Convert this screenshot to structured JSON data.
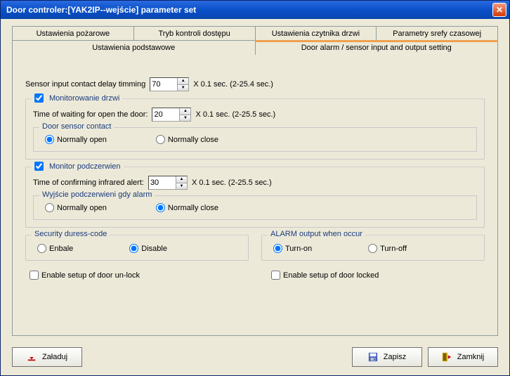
{
  "window": {
    "title": "Door controler:[YAK2IP--wejście] parameter set"
  },
  "tabs_row1": [
    {
      "label": "Ustawienia pożarowe"
    },
    {
      "label": "Tryb kontroli dostępu"
    },
    {
      "label": "Ustawienia czytnika drzwi"
    },
    {
      "label": "Parametry srefy czasowej"
    }
  ],
  "tabs_row2": [
    {
      "label": "Ustawienia podstawowe"
    },
    {
      "label": "Door alarm / sensor input and output setting"
    }
  ],
  "sensor_delay": {
    "label": "Sensor input contact delay timming",
    "value": "70",
    "suffix": "X 0.1 sec. (2-25.4 sec.)"
  },
  "door_monitor": {
    "title": "Monitorowanie drzwi",
    "checked": true,
    "wait_label": "Time of waiting for open the door:",
    "wait_value": "20",
    "wait_suffix": "X 0.1 sec. (2-25.5 sec.)",
    "contact_title": "Door sensor contact",
    "opt_open": "Normally open",
    "opt_close": "Normally close",
    "selected": "open"
  },
  "ir_monitor": {
    "title": "Monitor podczerwien",
    "checked": true,
    "confirm_label": "Time of confirming infrared alert:",
    "confirm_value": "30",
    "confirm_suffix": "X 0.1 sec. (2-25.5 sec.)",
    "output_title": "Wyjście podczerwieni gdy alarm",
    "opt_open": "Normally open",
    "opt_close": "Normally close",
    "selected": "close"
  },
  "duress": {
    "title": "Security duress-code",
    "opt_enable": "Enbale",
    "opt_disable": "Disable",
    "selected": "disable"
  },
  "alarm_out": {
    "title": "ALARM output when occur",
    "opt_on": "Turn-on",
    "opt_off": "Turn-off",
    "selected": "on"
  },
  "enable_unlock": {
    "label": "Enable setup of door un-lock",
    "checked": false
  },
  "enable_locked": {
    "label": "Enable setup of door locked",
    "checked": false
  },
  "buttons": {
    "load": "Załaduj",
    "save": "Zapisz",
    "close": "Zamknij"
  }
}
